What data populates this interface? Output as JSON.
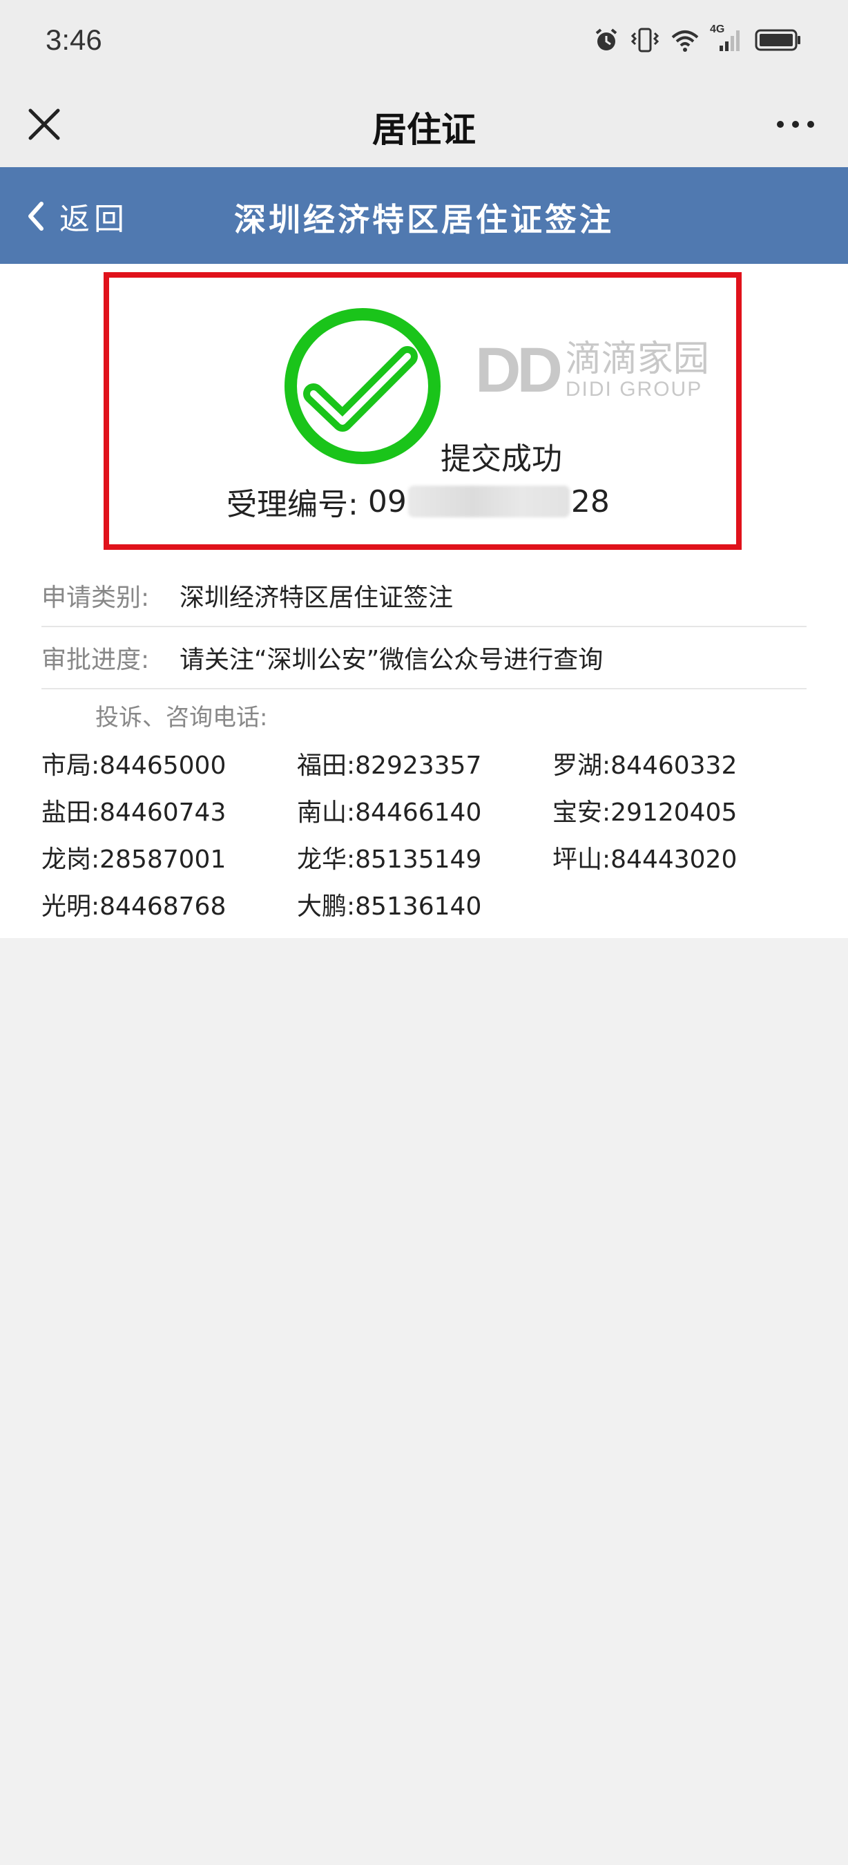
{
  "status_bar": {
    "time": "3:46",
    "network": "4G"
  },
  "title_bar": {
    "title": "居住证"
  },
  "header": {
    "back_label": "返回",
    "title": "深圳经济特区居住证签注"
  },
  "result": {
    "status_text": "提交成功",
    "receipt_label": "受理编号:",
    "receipt_prefix": "09",
    "receipt_suffix": "28",
    "watermark": {
      "mark": "DD",
      "name_cn": "滴滴家园",
      "name_en": "DIDI GROUP"
    },
    "accent_color": "#1ac41a",
    "border_color": "#e0121b"
  },
  "info_rows": [
    {
      "label": "申请类别:",
      "value": "深圳经济特区居住证签注"
    },
    {
      "label": "审批进度:",
      "value": "请关注“深圳公安”微信公众号进行查询"
    }
  ],
  "contacts": {
    "title": "投诉、咨询电话:",
    "items": [
      {
        "text": "市局:84465000"
      },
      {
        "text": "福田:82923357"
      },
      {
        "text": "罗湖:84460332"
      },
      {
        "text": "盐田:84460743"
      },
      {
        "text": "南山:84466140"
      },
      {
        "text": "宝安:29120405"
      },
      {
        "text": "龙岗:28587001"
      },
      {
        "text": "龙华:85135149"
      },
      {
        "text": "坪山:84443020"
      },
      {
        "text": "光明:84468768"
      },
      {
        "text": "大鹏:85136140"
      }
    ]
  },
  "colors": {
    "header_bg": "#5079b0",
    "page_bg": "#f1f1f1"
  }
}
